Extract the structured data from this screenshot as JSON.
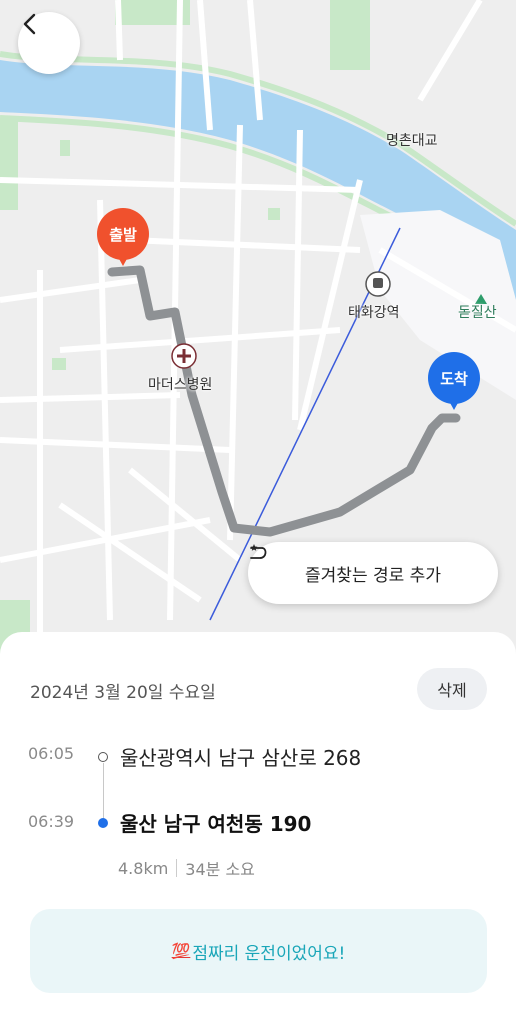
{
  "map": {
    "labels": {
      "bridge": "명촌대교",
      "station": "태화강역",
      "hospital": "마더스병원",
      "mountain": "돋질산"
    },
    "start_pin": "출발",
    "end_pin": "도착",
    "favorite_button_label": "즐겨찾는 경로 추가",
    "colors": {
      "route": "#8e9194",
      "river": "#a9d4f2",
      "park": "#c8e8c8",
      "start": "#f0512d",
      "end": "#1f6fe8"
    }
  },
  "sheet": {
    "date": "2024년 3월 20일 수요일",
    "delete_label": "삭제",
    "origin": {
      "time": "06:05",
      "address": "울산광역시 남구 삼산로 268"
    },
    "destination": {
      "time": "06:39",
      "address": "울산 남구 여천동 190"
    },
    "distance": "4.8km",
    "duration": "34분 소요",
    "score_emoji": "💯",
    "banner_text": "점짜리 운전이었어요!"
  }
}
